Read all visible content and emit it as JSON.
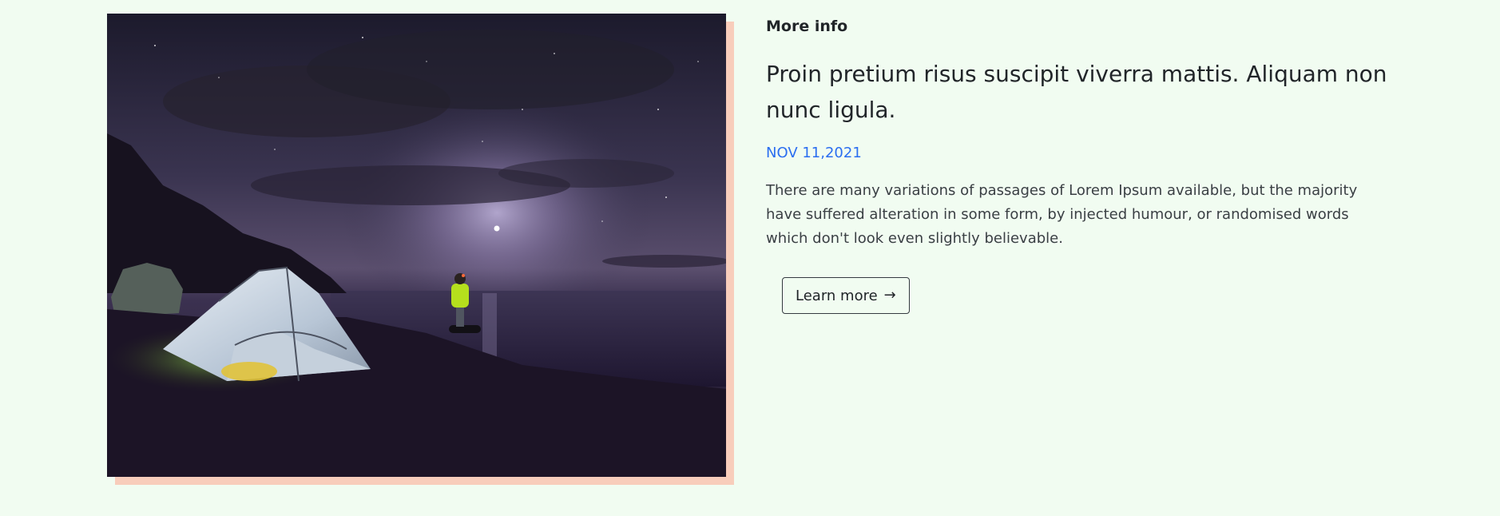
{
  "article": {
    "eyebrow": "More info",
    "headline": "Proin pretium risus suscipit viverra mattis. Aliquam non nunc ligula.",
    "date": "NOV 11,2021",
    "body": "There are many variations of passages of Lorem Ipsum available, but the majority have suffered alteration in some form, by injected humour, or randomised words which don't look even slightly believable.",
    "cta_label": "Learn more",
    "cta_icon": "arrow-right-icon"
  },
  "colors": {
    "page_background": "#f1fcf1",
    "image_shadow": "#f8cdbb",
    "date_accent": "#2b6ef0"
  },
  "image": {
    "subject": "tent-under-night-sky-photo"
  }
}
